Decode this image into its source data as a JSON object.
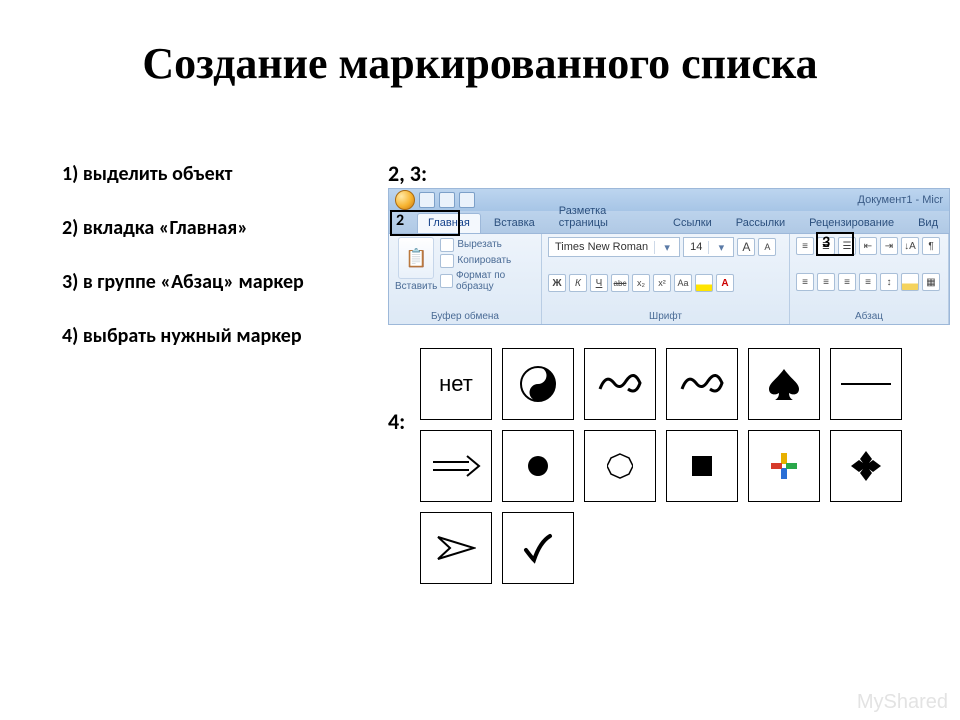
{
  "title": "Создание маркированного списка",
  "steps": {
    "s1": "1)   выделить объект",
    "s2": "2)  вкладка «Главная»",
    "s3": "3) в группе «Абзац» маркер",
    "s4": "4) выбрать нужный маркер"
  },
  "labels": {
    "l23": "2, 3:",
    "l4": "4:"
  },
  "callouts": {
    "n2": "2",
    "n3": "3"
  },
  "ribbon": {
    "doc_title": "Документ1 - Micr",
    "tabs": {
      "home": "Главная",
      "insert": "Вставка",
      "layout": "Разметка страницы",
      "refs": "Ссылки",
      "mail": "Рассылки",
      "review": "Рецензирование",
      "view": "Вид"
    },
    "clipboard": {
      "paste": "Вставить",
      "cut": "Вырезать",
      "copy": "Копировать",
      "format": "Формат по образцу",
      "group": "Буфер обмена"
    },
    "font": {
      "name": "Times New Roman",
      "size": "14",
      "bold": "Ж",
      "italic": "К",
      "underline": "Ч",
      "strike": "abc",
      "sub": "x₂",
      "sup": "x²",
      "case": "Aa",
      "grow": "A",
      "shrink": "A",
      "group": "Шрифт"
    },
    "paragraph": {
      "group": "Абзац"
    }
  },
  "bullets": {
    "r1": {
      "c1": "нет"
    }
  },
  "watermark": "MyShared"
}
